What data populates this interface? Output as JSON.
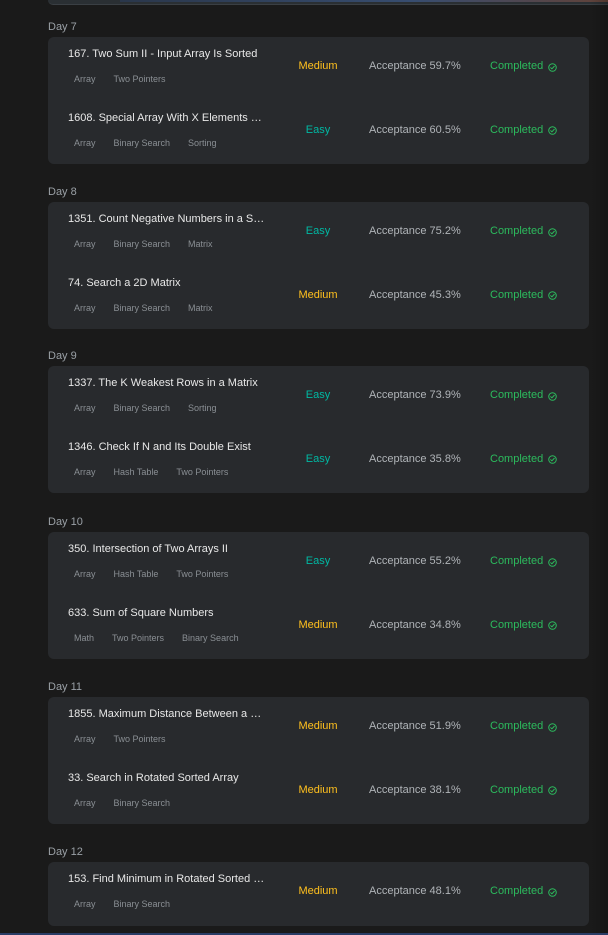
{
  "status_label": "Completed",
  "acceptance_label": "Acceptance",
  "colors": {
    "medium": "#ffc01e",
    "easy": "#00b8a3",
    "completed": "#2cbb5d"
  },
  "days": [
    {
      "label": "Day 7",
      "problems": [
        {
          "title": "167. Two Sum II - Input Array Is Sorted",
          "tags": [
            "Array",
            "Two Pointers"
          ],
          "difficulty": "Medium",
          "acceptance": "Acceptance 59.7%",
          "status": "Completed"
        },
        {
          "title": "1608. Special Array With X Elements …",
          "tags": [
            "Array",
            "Binary Search",
            "Sorting"
          ],
          "difficulty": "Easy",
          "acceptance": "Acceptance 60.5%",
          "status": "Completed"
        }
      ]
    },
    {
      "label": "Day 8",
      "problems": [
        {
          "title": "1351. Count Negative Numbers in a S…",
          "tags": [
            "Array",
            "Binary Search",
            "Matrix"
          ],
          "difficulty": "Easy",
          "acceptance": "Acceptance 75.2%",
          "status": "Completed"
        },
        {
          "title": "74. Search a 2D Matrix",
          "tags": [
            "Array",
            "Binary Search",
            "Matrix"
          ],
          "difficulty": "Medium",
          "acceptance": "Acceptance 45.3%",
          "status": "Completed"
        }
      ]
    },
    {
      "label": "Day 9",
      "problems": [
        {
          "title": "1337. The K Weakest Rows in a Matrix",
          "tags": [
            "Array",
            "Binary Search",
            "Sorting"
          ],
          "difficulty": "Easy",
          "acceptance": "Acceptance 73.9%",
          "status": "Completed"
        },
        {
          "title": "1346. Check If N and Its Double Exist",
          "tags": [
            "Array",
            "Hash Table",
            "Two Pointers"
          ],
          "difficulty": "Easy",
          "acceptance": "Acceptance 35.8%",
          "status": "Completed"
        }
      ]
    },
    {
      "label": "Day 10",
      "problems": [
        {
          "title": "350. Intersection of Two Arrays II",
          "tags": [
            "Array",
            "Hash Table",
            "Two Pointers"
          ],
          "difficulty": "Easy",
          "acceptance": "Acceptance 55.2%",
          "status": "Completed"
        },
        {
          "title": "633. Sum of Square Numbers",
          "tags": [
            "Math",
            "Two Pointers",
            "Binary Search"
          ],
          "difficulty": "Medium",
          "acceptance": "Acceptance 34.8%",
          "status": "Completed"
        }
      ]
    },
    {
      "label": "Day 11",
      "problems": [
        {
          "title": "1855. Maximum Distance Between a …",
          "tags": [
            "Array",
            "Two Pointers"
          ],
          "difficulty": "Medium",
          "acceptance": "Acceptance 51.9%",
          "status": "Completed"
        },
        {
          "title": "33. Search in Rotated Sorted Array",
          "tags": [
            "Array",
            "Binary Search"
          ],
          "difficulty": "Medium",
          "acceptance": "Acceptance 38.1%",
          "status": "Completed"
        }
      ]
    },
    {
      "label": "Day 12",
      "problems": [
        {
          "title": "153. Find Minimum in Rotated Sorted …",
          "tags": [
            "Array",
            "Binary Search"
          ],
          "difficulty": "Medium",
          "acceptance": "Acceptance 48.1%",
          "status": "Completed"
        }
      ]
    }
  ]
}
